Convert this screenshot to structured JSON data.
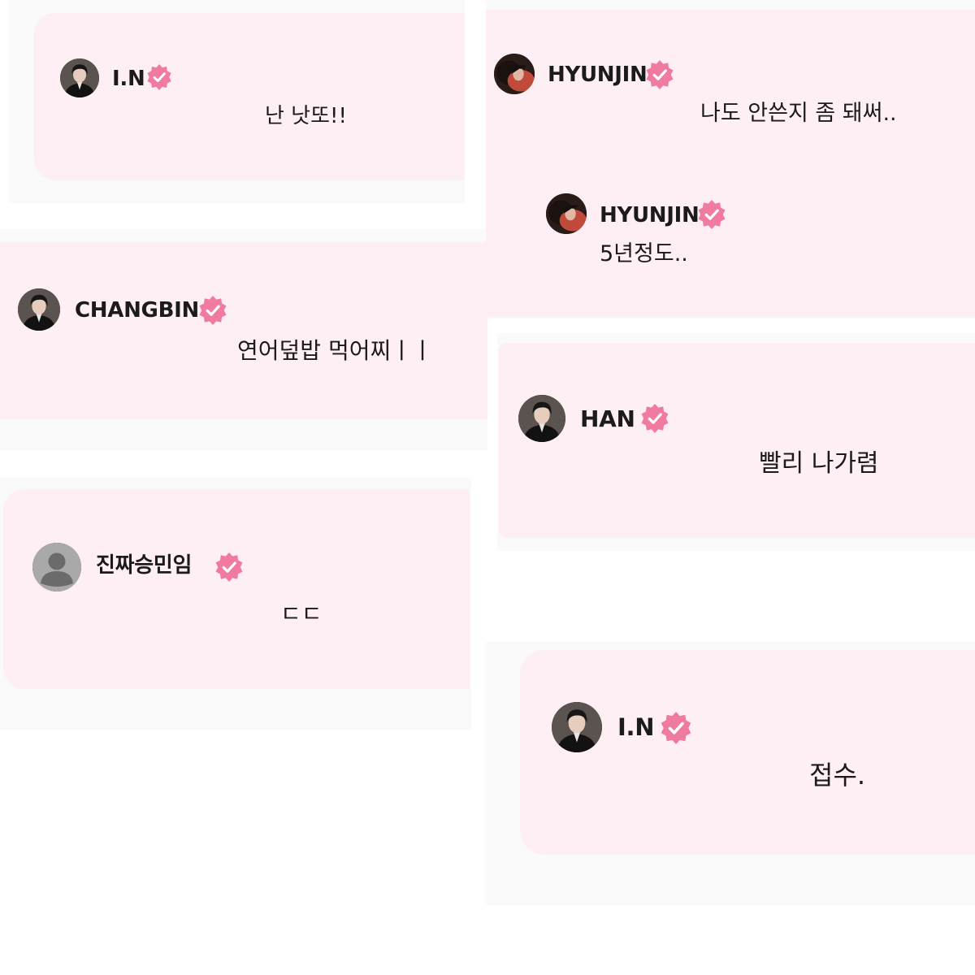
{
  "colors": {
    "card_bg": "#fdeff3",
    "badge": "#f07aa0",
    "badge_check": "#ffffff",
    "text": "#1b1b1b"
  },
  "icons": {
    "verified_badge": "verified-badge-icon",
    "default_avatar": "default-avatar-icon"
  },
  "comments": [
    {
      "user": "I.N",
      "message": "난 낫또!!",
      "verified": true
    },
    {
      "user": "CHANGBIN",
      "message": "연어덮밥 먹어찌ㅣㅣ",
      "verified": true
    },
    {
      "user": "진짜승민임",
      "message": "ㄷㄷ",
      "verified": true,
      "avatar": "default"
    },
    {
      "user": "HYUNJIN",
      "message": "나도 안쓴지 좀 돼써..",
      "verified": true
    },
    {
      "user": "HYUNJIN",
      "message": "5년정도..",
      "verified": true
    },
    {
      "user": "HAN",
      "message": "빨리 나가렴",
      "verified": true
    },
    {
      "user": "I.N",
      "message": "접수.",
      "verified": true
    }
  ]
}
